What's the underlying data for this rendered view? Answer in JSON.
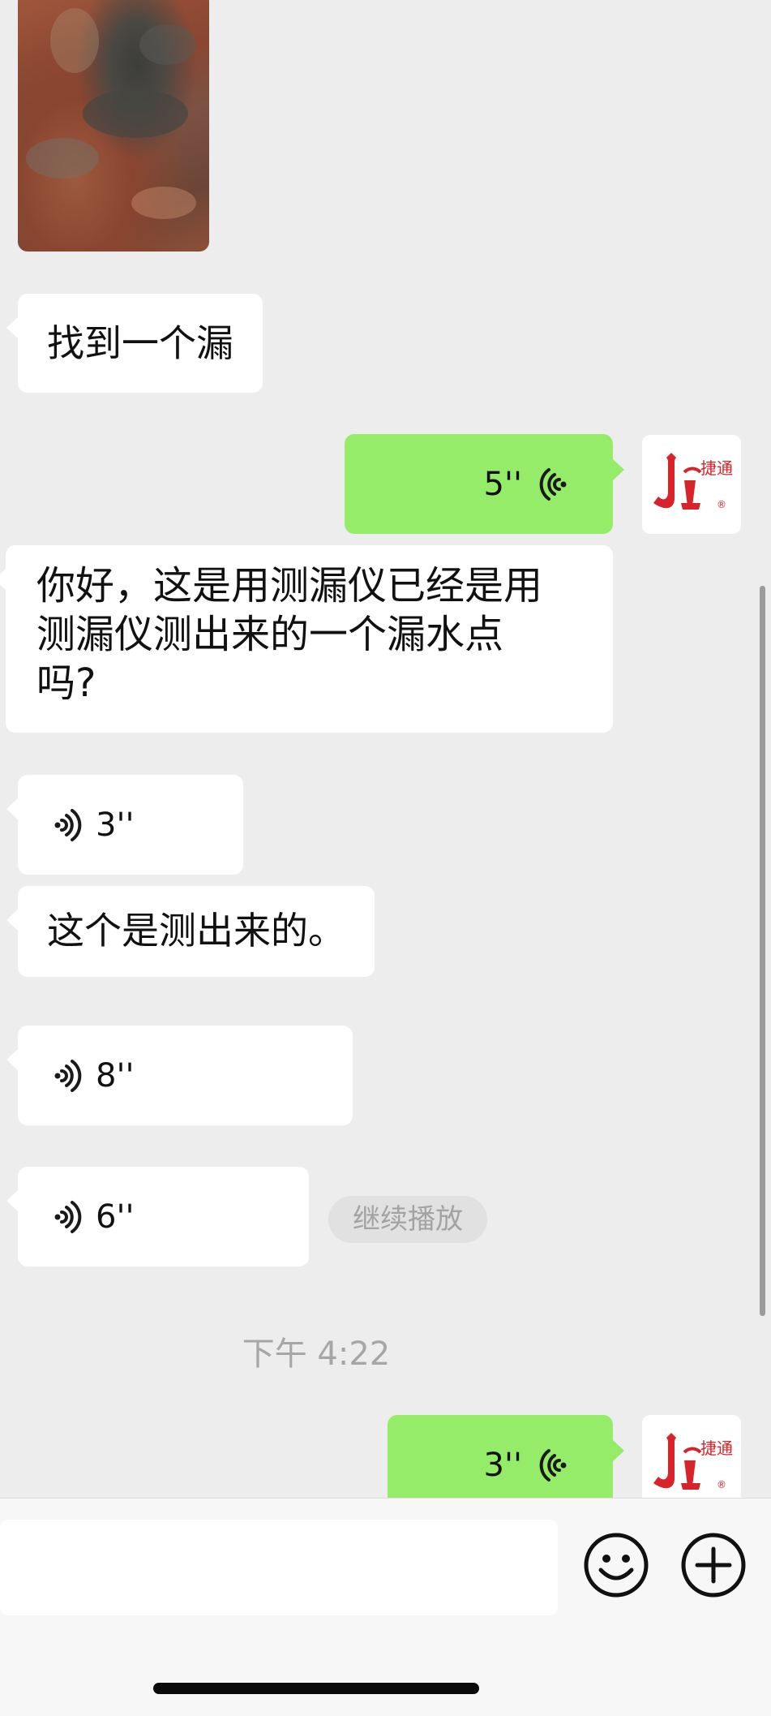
{
  "messages": [
    {
      "kind": "image",
      "side": "in"
    },
    {
      "kind": "text",
      "side": "in",
      "text": "找到一个漏"
    },
    {
      "kind": "voice",
      "side": "out",
      "duration": "5''"
    },
    {
      "kind": "text",
      "side": "in",
      "lines": [
        "你好，这是用测漏仪已经是用",
        "测漏仪测出来的一个漏水点",
        "吗?"
      ]
    },
    {
      "kind": "voice",
      "side": "in",
      "duration": "3''"
    },
    {
      "kind": "text",
      "side": "in",
      "text": "这个是测出来的。"
    },
    {
      "kind": "voice",
      "side": "in",
      "duration": "8''"
    },
    {
      "kind": "voice",
      "side": "in",
      "duration": "6''"
    },
    {
      "kind": "timestamp",
      "text": "下午 4:22"
    },
    {
      "kind": "voice",
      "side": "out",
      "duration": "3''"
    }
  ],
  "continue_play_label": "继续播放",
  "avatar": {
    "logo_text": "捷通",
    "trademark": "®",
    "brand_red": "#d8232a"
  },
  "colors": {
    "outgoing_bubble": "#95ec69",
    "incoming_bubble": "#ffffff",
    "background": "#ededed"
  },
  "input_bar": {
    "placeholder": "",
    "icons": [
      "emoji-icon",
      "plus-icon"
    ]
  }
}
